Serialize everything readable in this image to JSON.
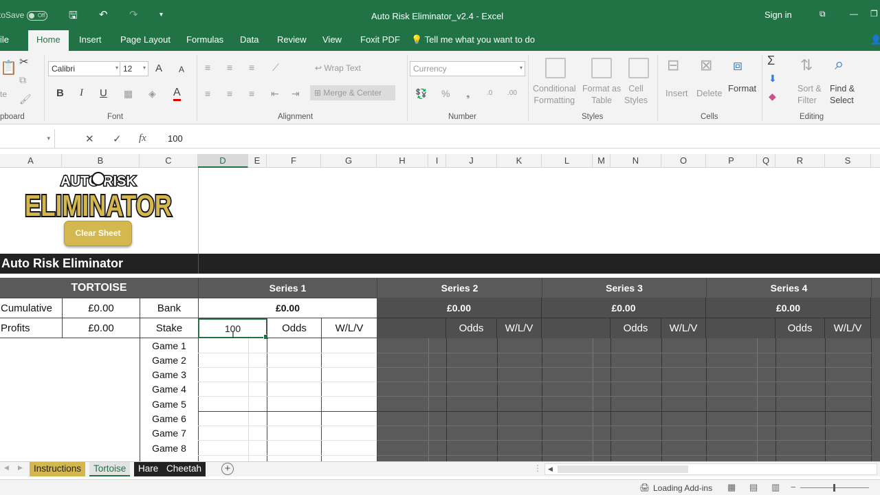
{
  "window": {
    "title": "Auto Risk Eliminator_v2.4  -  Excel",
    "autosave_label": "toSave",
    "autosave_state": "Off",
    "sign_in": "Sign in"
  },
  "ribbon_tabs": [
    "ile",
    "Home",
    "Insert",
    "Page Layout",
    "Formulas",
    "Data",
    "Review",
    "View",
    "Foxit PDF"
  ],
  "tell_me": "Tell me what you want to do",
  "ribbon": {
    "clipboard": {
      "paste": "te",
      "label": "pboard"
    },
    "font": {
      "name": "Calibri",
      "size": "12",
      "label": "Font",
      "bold": "B",
      "italic": "I",
      "underline": "U",
      "grow": "A",
      "shrink": "A",
      "font_color": "A"
    },
    "alignment": {
      "wrap_text": "Wrap Text",
      "merge_center": "Merge & Center",
      "label": "Alignment"
    },
    "number": {
      "format": "Currency",
      "percent": "%",
      "label": "Number"
    },
    "styles": {
      "conditional": [
        "Conditional",
        "Formatting"
      ],
      "format_table": [
        "Format as",
        "Table"
      ],
      "cell_styles": [
        "Cell",
        "Styles"
      ],
      "label": "Styles"
    },
    "cells": {
      "insert": "Insert",
      "delete": "Delete",
      "format": "Format",
      "label": "Cells"
    },
    "editing": {
      "sort_filter": [
        "Sort &",
        "Filter"
      ],
      "find_select": [
        "Find &",
        "Select"
      ],
      "label": "Editing"
    }
  },
  "formula_bar": {
    "value": "100",
    "fx": "fx",
    "cancel": "✕",
    "enter": "✓"
  },
  "columns": [
    "A",
    "B",
    "C",
    "D",
    "E",
    "F",
    "G",
    "H",
    "I",
    "J",
    "K",
    "L",
    "M",
    "N",
    "O",
    "P",
    "Q",
    "R",
    "S"
  ],
  "sheet": {
    "clear_button": "Clear Sheet",
    "logo_top": "AUTO RISK",
    "logo_bottom": "ELIMINATOR",
    "title": "Auto Risk Eliminator",
    "tortoise": "TORTOISE",
    "cumulative_label": "Cumulative",
    "cumulative_value": "£0.00",
    "profits_label": "Profits",
    "profits_value": "£0.00",
    "bank_label": "Bank",
    "stake_label": "Stake",
    "series": [
      {
        "name": "Series 1",
        "bank": "£0.00",
        "stake": "100",
        "odds": "Odds",
        "wlv": "W/L/V"
      },
      {
        "name": "Series 2",
        "bank": "£0.00",
        "odds": "Odds",
        "wlv": "W/L/V"
      },
      {
        "name": "Series 3",
        "bank": "£0.00",
        "odds": "Odds",
        "wlv": "W/L/V"
      },
      {
        "name": "Series 4",
        "bank": "£0.00",
        "odds": "Odds",
        "wlv": "W/L/V"
      }
    ],
    "games": [
      "Game 1",
      "Game 2",
      "Game 3",
      "Game 4",
      "Game 5",
      "Game 6",
      "Game 7",
      "Game 8"
    ]
  },
  "sheet_tabs": [
    {
      "label": "Instructions",
      "color": "#d4b84e"
    },
    {
      "label": "Tortoise",
      "color": "#e6e6e6",
      "active": true
    },
    {
      "label": "Hare",
      "color": "#222222"
    },
    {
      "label": "Cheetah",
      "color": "#222222"
    }
  ],
  "status": {
    "loading": "Loading Add-ins"
  },
  "colors": {
    "excel_green": "#217346",
    "dark_band": "#222222",
    "series_bg": "#5a5a5a",
    "gold": "#d4b84e"
  }
}
